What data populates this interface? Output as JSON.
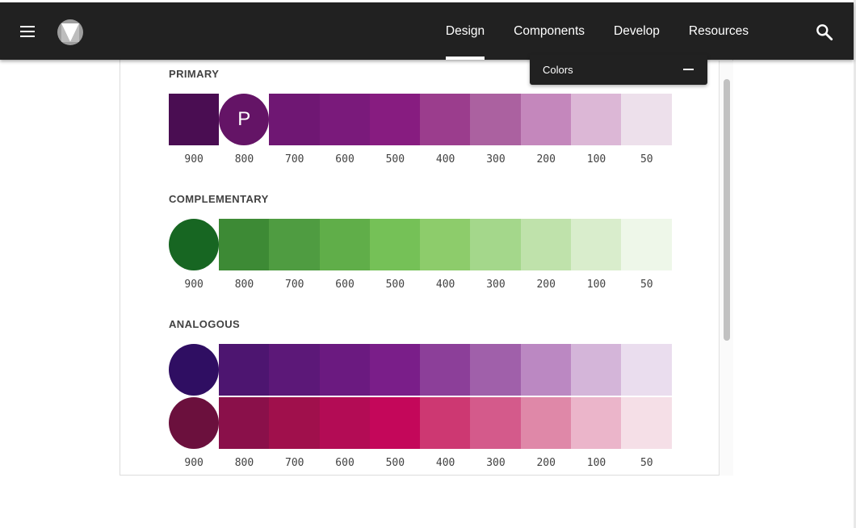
{
  "nav": {
    "tabs": [
      {
        "label": "Design",
        "active": true
      },
      {
        "label": "Components",
        "active": false
      },
      {
        "label": "Develop",
        "active": false
      },
      {
        "label": "Resources",
        "active": false
      }
    ],
    "menu_icon": "hamburger-menu-icon",
    "logo_icon": "material-logo-icon",
    "search_icon": "search-icon"
  },
  "colors_panel": {
    "title": "Colors",
    "toggle_icon": "minus-icon"
  },
  "shades": [
    "900",
    "800",
    "700",
    "600",
    "500",
    "400",
    "300",
    "200",
    "100",
    "50"
  ],
  "sections": {
    "primary": {
      "label": "PRIMARY",
      "circle_letter": "P",
      "circle_index": 1,
      "colors": [
        "#4a0d52",
        "#641466",
        "#6f1773",
        "#7a1a7b",
        "#871c80",
        "#9b3d8d",
        "#ab61a0",
        "#c487bc",
        "#dcb7d6",
        "#ede0eb"
      ]
    },
    "complementary": {
      "label": "COMPLEMENTARY",
      "circle_index": 0,
      "colors": [
        "#176622",
        "#3d8a35",
        "#4f9c41",
        "#60ae49",
        "#75c157",
        "#8dcc6b",
        "#a4d78b",
        "#bfe2ab",
        "#d9edcc",
        "#eef7e9"
      ]
    },
    "analogous": {
      "label": "ANALOGOUS",
      "rows": [
        {
          "circle_index": 0,
          "colors": [
            "#2f0e62",
            "#4d1570",
            "#5c1878",
            "#6b1a80",
            "#7a1e89",
            "#8c3f99",
            "#a060aa",
            "#bb88c2",
            "#d4b5d9",
            "#eaddee"
          ]
        },
        {
          "circle_index": 0,
          "colors": [
            "#6b103d",
            "#8a104a",
            "#a0104c",
            "#b30c55",
            "#c4075a",
            "#cd3872",
            "#d45a8b",
            "#df88a8",
            "#ebb5ca",
            "#f5dfe7"
          ]
        }
      ]
    }
  }
}
